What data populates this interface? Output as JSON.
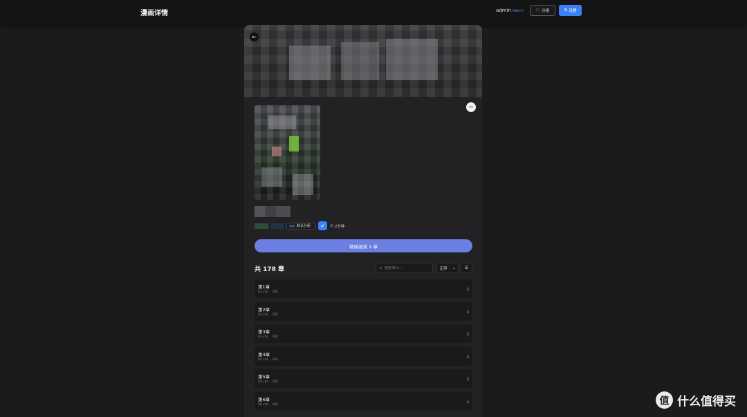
{
  "header": {
    "app_title": "漫画详情",
    "user_name": "admin",
    "user_role": "Admin",
    "group_button": "分组",
    "settings_button": "设置"
  },
  "comic": {
    "group_tag": "默认分组",
    "read_time": "2分钟",
    "continue_button": "继续阅读 1 章",
    "chapter_count": "共 178 章"
  },
  "search": {
    "placeholder": "搜索章节..."
  },
  "sort": {
    "selected": "正序"
  },
  "chapters": [
    {
      "title": "第1章",
      "file": "01.cbz",
      "format": "CBZ"
    },
    {
      "title": "第2章",
      "file": "02.cbz",
      "format": "CBZ"
    },
    {
      "title": "第3章",
      "file": "03.cbz",
      "format": "CBZ"
    },
    {
      "title": "第4章",
      "file": "04.cbz",
      "format": "CBZ"
    },
    {
      "title": "第5章",
      "file": "05.cbz",
      "format": "CBZ"
    },
    {
      "title": "第6章",
      "file": "06.cbz",
      "format": "CBZ"
    }
  ],
  "watermark": {
    "logo": "值",
    "text": "什么值得买"
  },
  "icons": {
    "back": "arrow-left-icon",
    "more": "ellipsis-icon",
    "folder": "folder-icon",
    "gear": "gear-icon",
    "check": "check-icon",
    "clock": "clock-icon",
    "search": "search-icon",
    "download": "download-icon",
    "list": "list-icon"
  },
  "colors": {
    "accent": "#3b82f6",
    "read_button": "#6b7fe0",
    "background": "#1b1b1d"
  }
}
